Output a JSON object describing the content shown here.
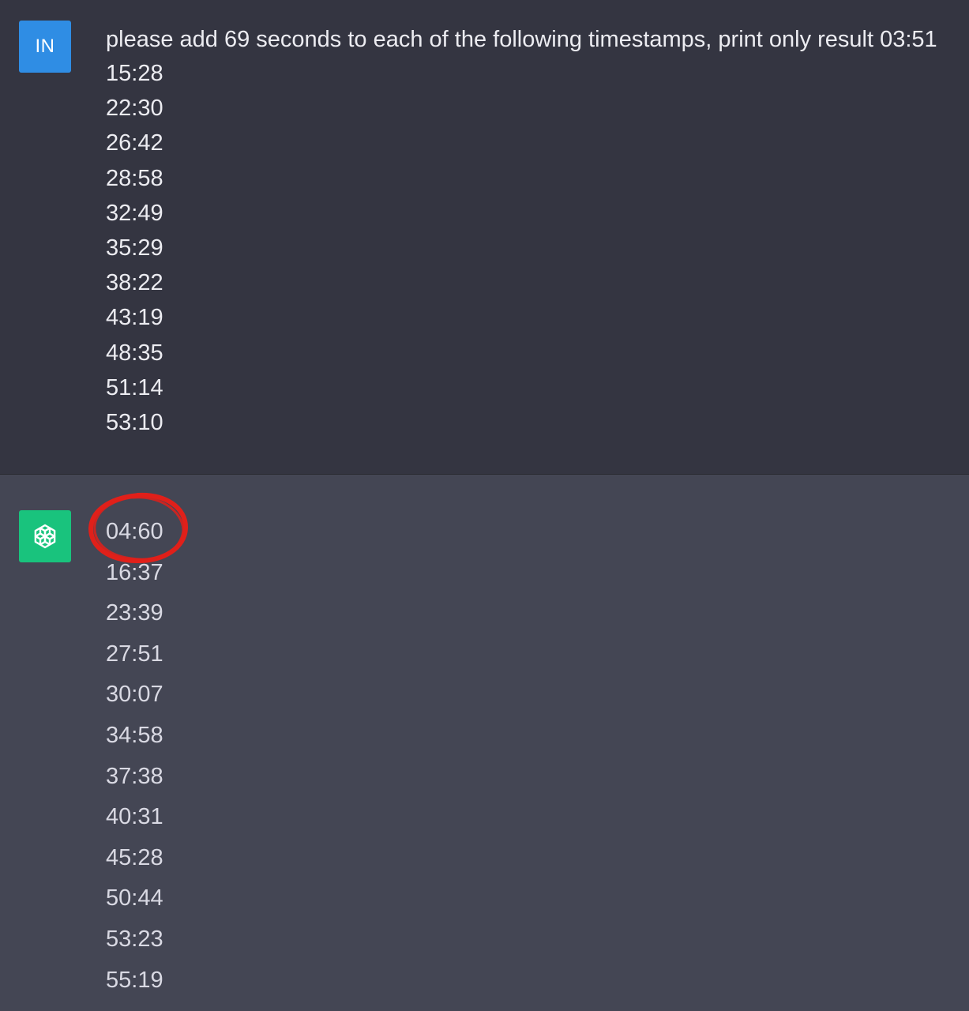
{
  "user_message": {
    "avatar_label": "IN",
    "prompt": "please add 69 seconds to each of the following timestamps, print only result 03:51",
    "timestamps": [
      "15:28",
      "22:30",
      "26:42",
      "28:58",
      "32:49",
      "35:29",
      "38:22",
      "43:19",
      "48:35",
      "51:14",
      "53:10"
    ]
  },
  "assistant_message": {
    "avatar_icon": "openai-logo-icon",
    "timestamps": [
      "04:60",
      "16:37",
      "23:39",
      "27:51",
      "30:07",
      "34:58",
      "37:38",
      "40:31",
      "45:28",
      "50:44",
      "53:23",
      "55:19"
    ]
  },
  "annotation": {
    "icon": "red-circle-annotation",
    "color": "#e0201a",
    "target": "04:60"
  },
  "colors": {
    "user_bg": "#343541",
    "assistant_bg": "#444654",
    "user_avatar": "#2f8de4",
    "assistant_avatar": "#19c37d"
  }
}
